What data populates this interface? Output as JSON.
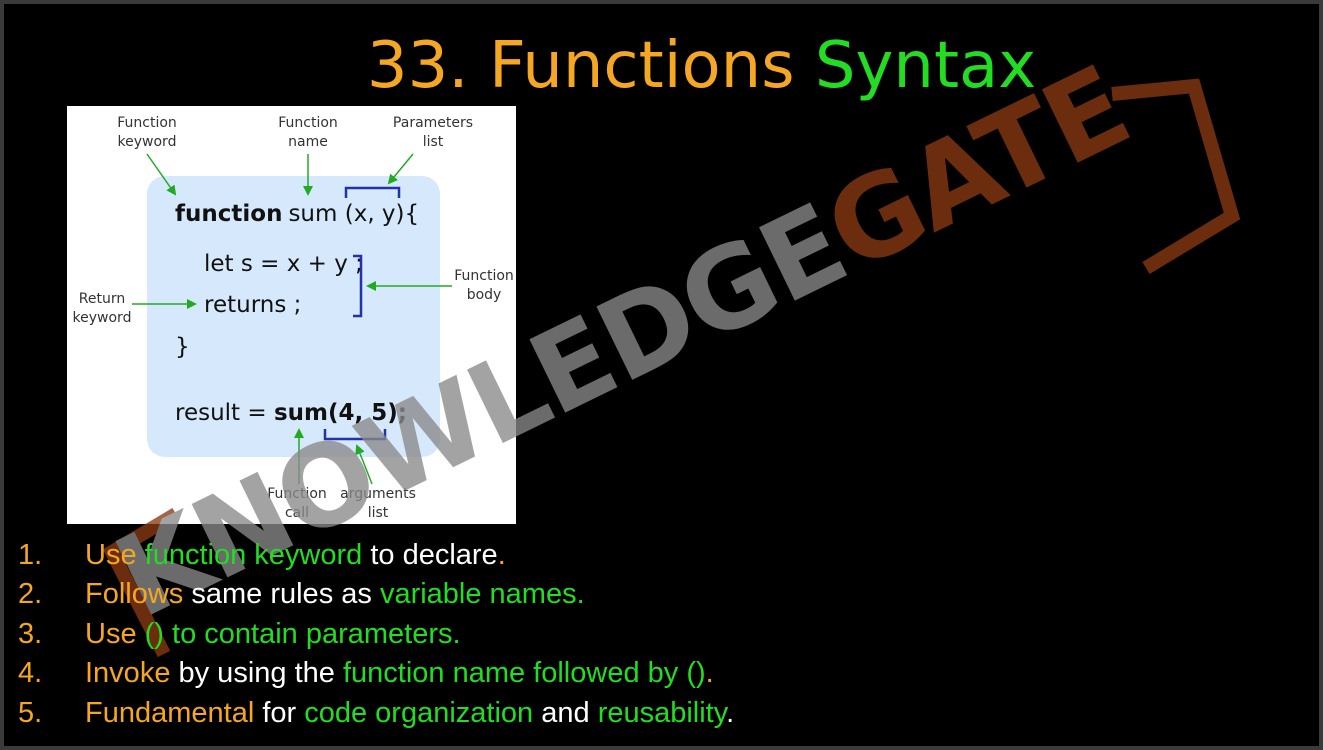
{
  "title": {
    "number": "33.",
    "word1": "Functions",
    "word2": "Syntax"
  },
  "figure": {
    "labels": {
      "function_keyword": [
        "Function",
        "keyword"
      ],
      "function_name": [
        "Function",
        "name"
      ],
      "parameters_list": [
        "Parameters",
        "list"
      ],
      "function_body": [
        "Function",
        "body"
      ],
      "return_keyword": [
        "Return",
        "keyword"
      ],
      "function_call": [
        "Function",
        "call"
      ],
      "arguments_list": [
        "arguments",
        "list"
      ]
    },
    "code": {
      "line1_keyword": "function",
      "line1_rest": "sum (x, y){",
      "line2": "let s = x + y ;",
      "line3": "returns ;",
      "line4": "}",
      "line5_prefix": "result = ",
      "line5_call": "sum(4, 5);"
    }
  },
  "watermark": {
    "text_grey": "KNOWLEDGE",
    "text_brown": "GATE"
  },
  "list": [
    {
      "num": "1.",
      "parts": [
        {
          "t": "Use ",
          "c": "o"
        },
        {
          "t": "function keyword",
          "c": "g"
        },
        {
          "t": " to declare",
          "c": "w"
        },
        {
          "t": ".",
          "c": "o"
        }
      ]
    },
    {
      "num": "2.",
      "parts": [
        {
          "t": "Follows ",
          "c": "o"
        },
        {
          "t": "same rules as ",
          "c": "w"
        },
        {
          "t": "variable names.",
          "c": "g"
        }
      ]
    },
    {
      "num": "3.",
      "parts": [
        {
          "t": "Use ",
          "c": "o"
        },
        {
          "t": "() to contain parameters.",
          "c": "g"
        }
      ]
    },
    {
      "num": "4.",
      "parts": [
        {
          "t": "Invoke ",
          "c": "o"
        },
        {
          "t": "by using the ",
          "c": "w"
        },
        {
          "t": "function name followed by ()",
          "c": "g"
        },
        {
          "t": ".",
          "c": "o"
        }
      ]
    },
    {
      "num": "5.",
      "parts": [
        {
          "t": "Fundamental ",
          "c": "o"
        },
        {
          "t": "for ",
          "c": "w"
        },
        {
          "t": "code organization ",
          "c": "g"
        },
        {
          "t": "and ",
          "c": "w"
        },
        {
          "t": "reusability",
          "c": "g"
        },
        {
          "t": ".",
          "c": "w"
        }
      ]
    }
  ],
  "colors": {
    "orange": "#f5a623",
    "green": "#22dd22",
    "white": "#ffffff",
    "background": "#000000",
    "code_box": "#d6e8fb",
    "arrow": "#22aa22",
    "bracket": "#2233aa",
    "watermark_grey": "#8a8a8a",
    "watermark_brown": "#8a3a12"
  }
}
